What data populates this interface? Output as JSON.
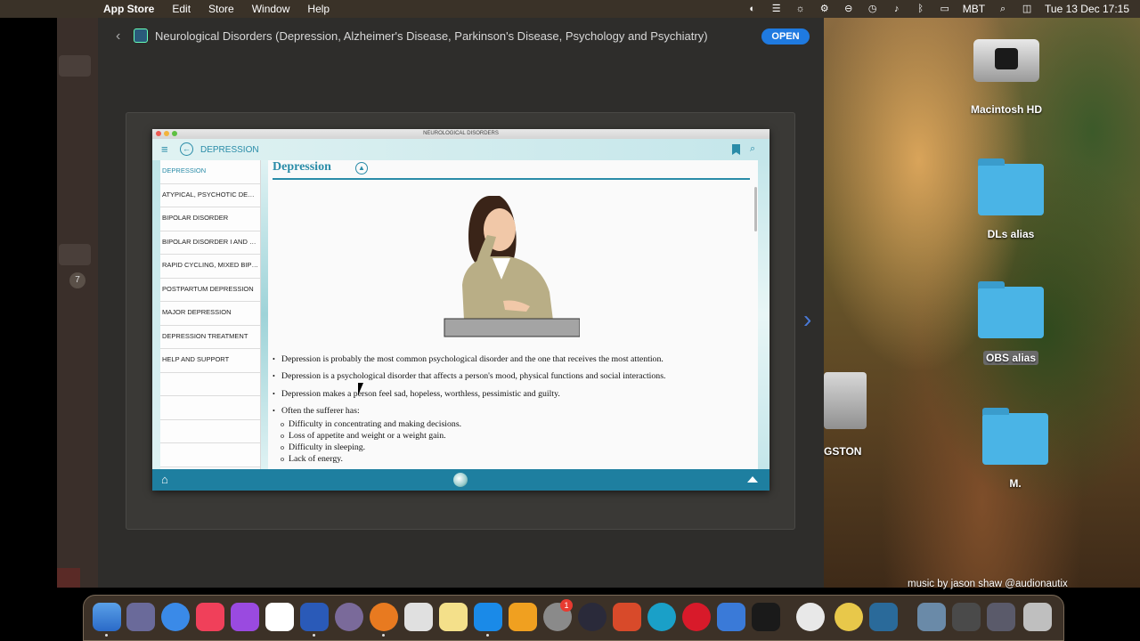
{
  "menubar": {
    "app_name": "App Store",
    "menus": [
      "Edit",
      "Store",
      "Window",
      "Help"
    ],
    "keyboard_layout": "MBT",
    "datetime": "Tue 13 Dec  17:15"
  },
  "appstore": {
    "app_title": "Neurological Disorders (Depression, Alzheimer's Disease, Parkinson's Disease, Psychology and Psychiatry)",
    "open_label": "OPEN",
    "sidebar_badge": "7"
  },
  "inner_app": {
    "window_title": "NEUROLOGICAL DISORDERS",
    "header_title": "DEPRESSION",
    "nav_items": [
      "DEPRESSION",
      "ATYPICAL, PSYCHOTIC DEPRE...",
      "BIPOLAR DISORDER",
      "BIPOLAR DISORDER I AND BIP...",
      "RAPID CYCLING, MIXED BIPO...",
      "POSTPARTUM DEPRESSION",
      "MAJOR DEPRESSION",
      "DEPRESSION TREATMENT",
      "HELP AND SUPPORT"
    ],
    "content_title": "Depression",
    "bullets": [
      "Depression is probably the most common psychological disorder and the one that receives the most attention.",
      "Depression is a psychological disorder that affects a person's mood, physical functions and social interactions.",
      "Depression makes a person feel sad, hopeless, worthless, pessimistic and guilty.",
      "Often the sufferer has:"
    ],
    "sub_bullets": [
      "Difficulty in concentrating and making decisions.",
      "Loss of appetite and weight or a weight gain.",
      "Difficulty in sleeping.",
      "Lack of energy."
    ]
  },
  "desktop": {
    "icons": [
      "Macintosh HD",
      "DLs alias",
      "OBS alias",
      "GSTON",
      "M."
    ]
  },
  "credit": "music by jason shaw @audionautix",
  "dock": {
    "notification_badge": "1"
  }
}
